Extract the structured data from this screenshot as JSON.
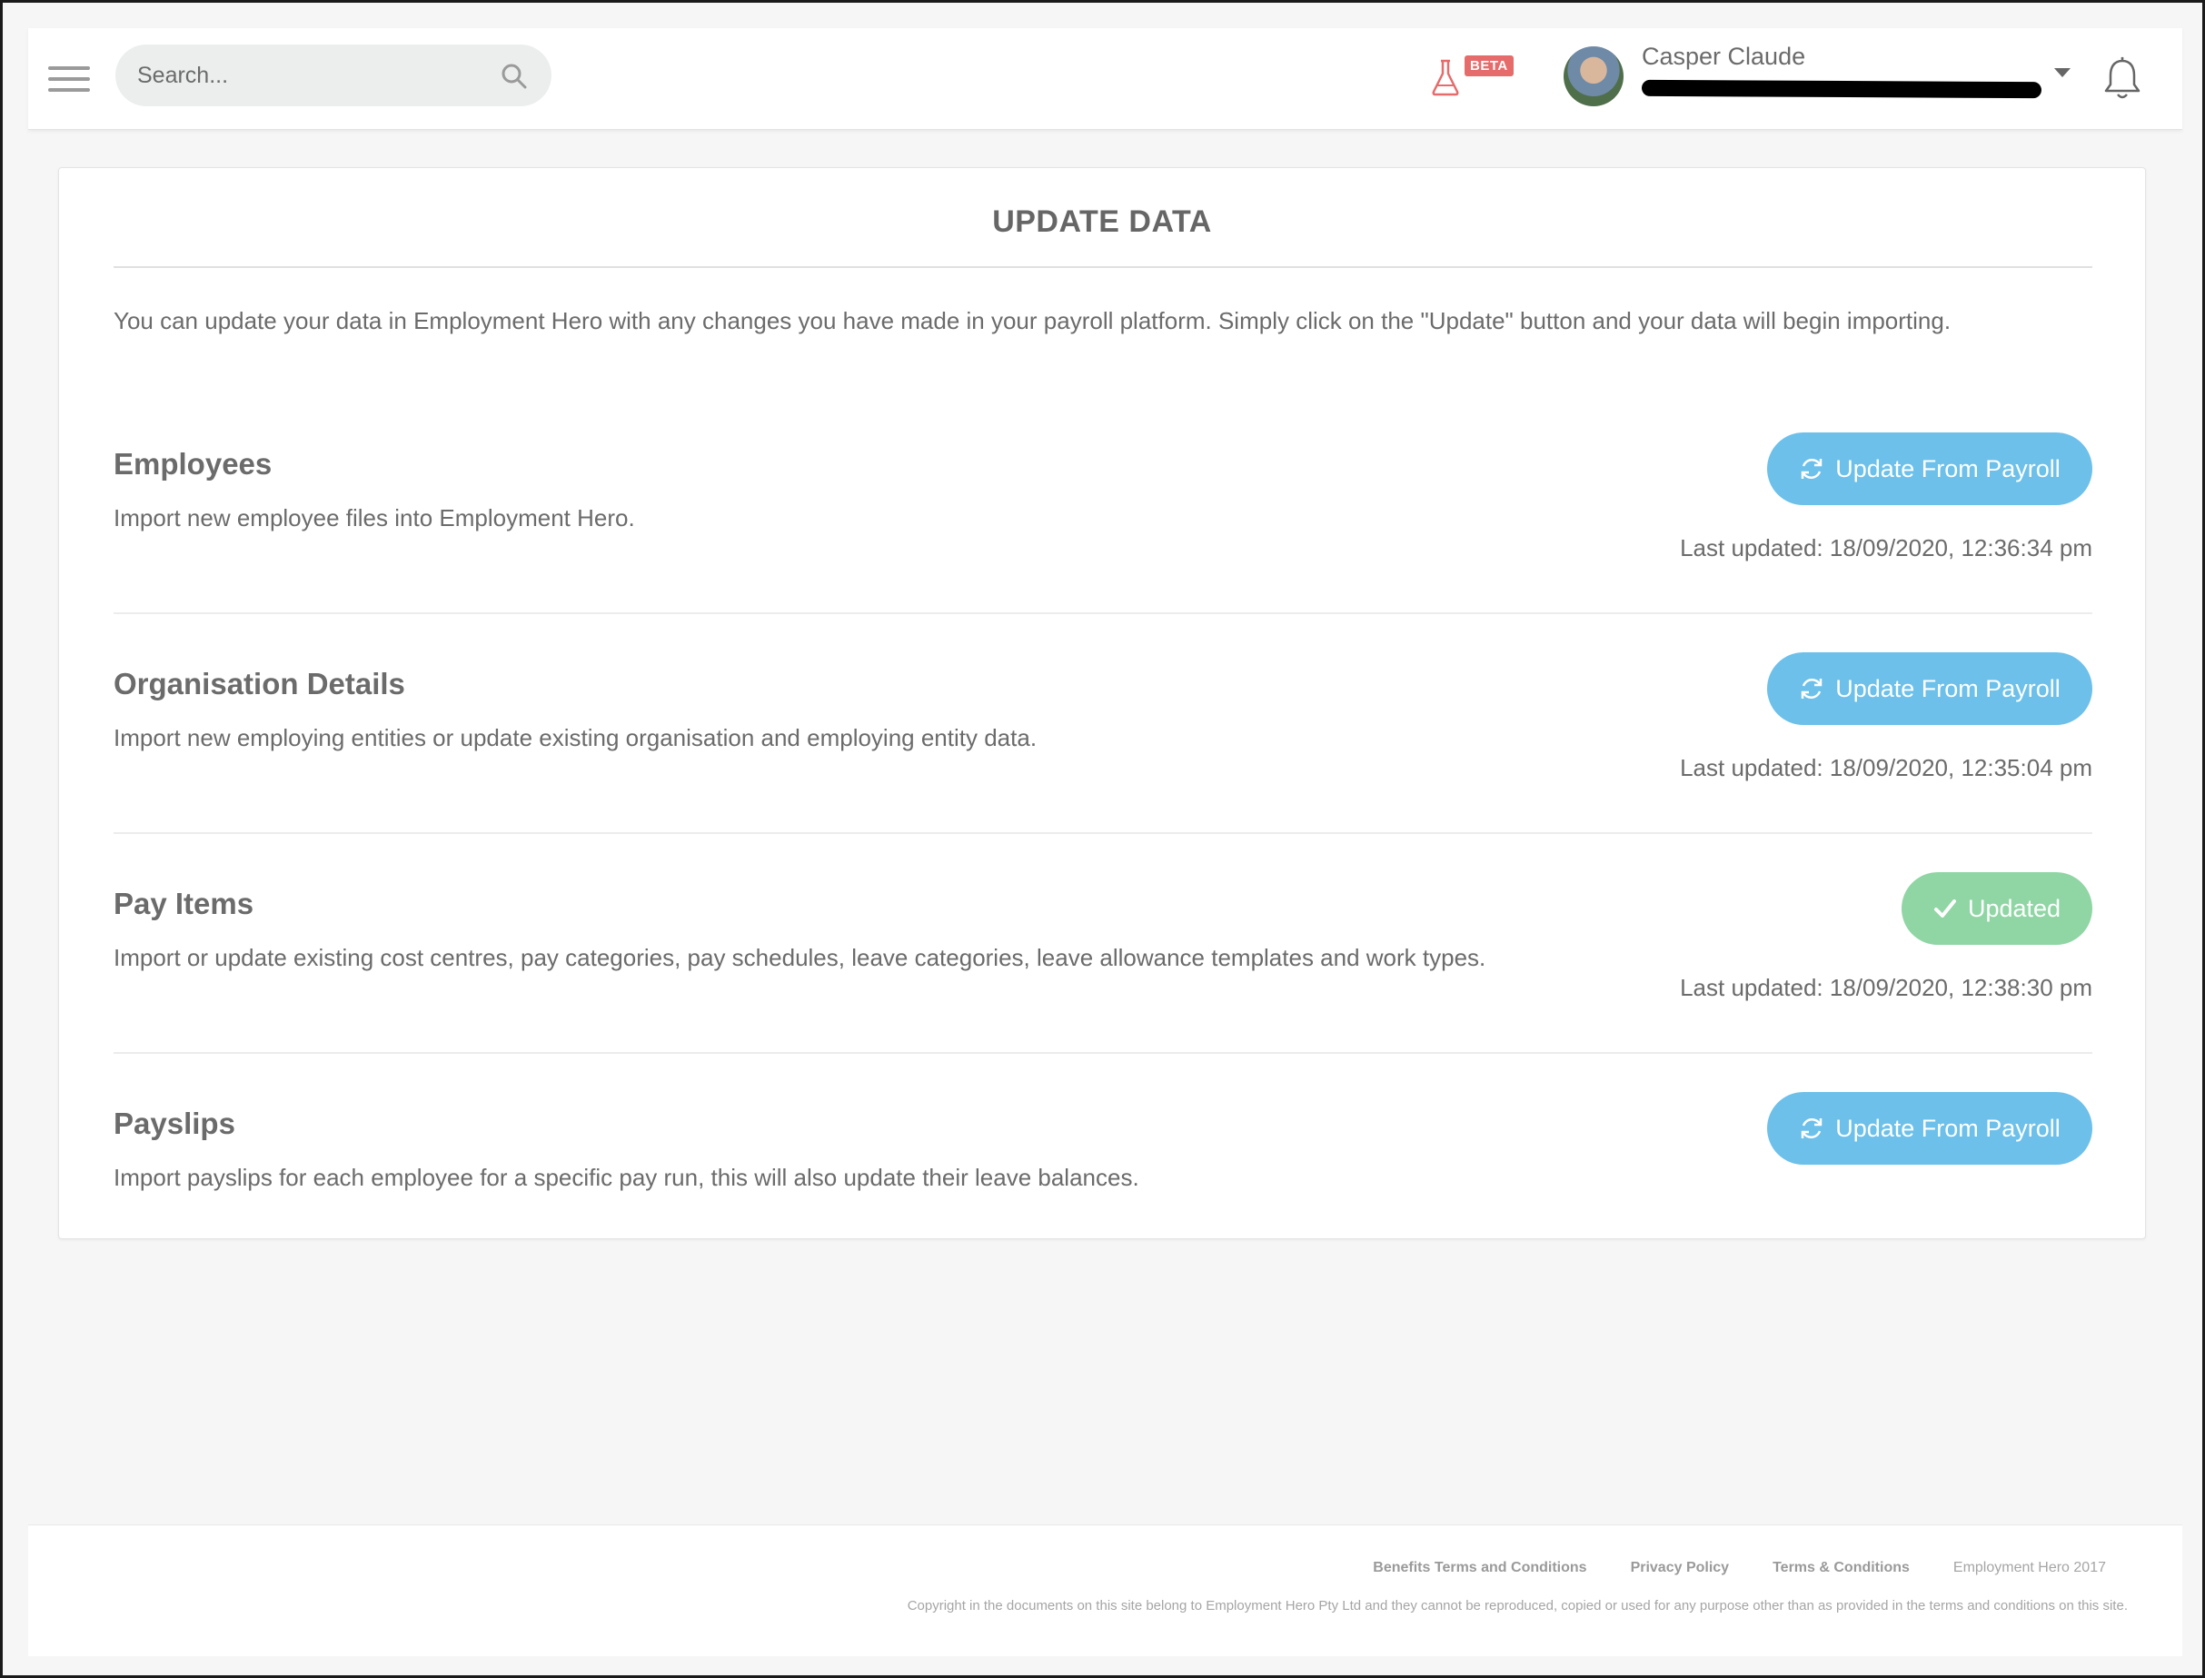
{
  "header": {
    "search_placeholder": "Search...",
    "beta_label": "BETA",
    "user_name": "Casper Claude"
  },
  "page": {
    "title": "UPDATE DATA",
    "intro": "You can update your data in Employment Hero with any changes you have made in your payroll platform. Simply click on the \"Update\" button and your data will begin importing."
  },
  "sections": [
    {
      "title": "Employees",
      "description": "Import new employee files into Employment Hero.",
      "button_label": "Update From Payroll",
      "button_state": "update",
      "last_updated": "Last updated: 18/09/2020, 12:36:34 pm"
    },
    {
      "title": "Organisation Details",
      "description": "Import new employing entities or update existing organisation and employing entity data.",
      "button_label": "Update From Payroll",
      "button_state": "update",
      "last_updated": "Last updated: 18/09/2020, 12:35:04 pm"
    },
    {
      "title": "Pay Items",
      "description": "Import or update existing cost centres, pay categories, pay schedules, leave categories, leave allowance templates and work types.",
      "button_label": "Updated",
      "button_state": "updated",
      "last_updated": "Last updated: 18/09/2020, 12:38:30 pm"
    },
    {
      "title": "Payslips",
      "description": "Import payslips for each employee for a specific pay run, this will also update their leave balances.",
      "button_label": "Update From Payroll",
      "button_state": "update",
      "last_updated": ""
    }
  ],
  "footer": {
    "links": [
      "Benefits Terms and Conditions",
      "Privacy Policy",
      "Terms & Conditions"
    ],
    "brand": "Employment Hero 2017",
    "copyright": "Copyright in the documents on this site belong to Employment Hero Pty Ltd and they cannot be reproduced, copied or used for any purpose other than as provided in the terms and conditions on this site."
  },
  "colors": {
    "update_button": "#6cc0ea",
    "updated_button": "#8fd6a4",
    "beta_badge": "#e66b6b"
  },
  "icons": {
    "menu": "hamburger-icon",
    "search": "search-icon",
    "beta": "flask-icon",
    "user_menu": "chevron-down-icon",
    "notifications": "bell-icon",
    "update": "refresh-icon",
    "updated": "check-icon"
  }
}
